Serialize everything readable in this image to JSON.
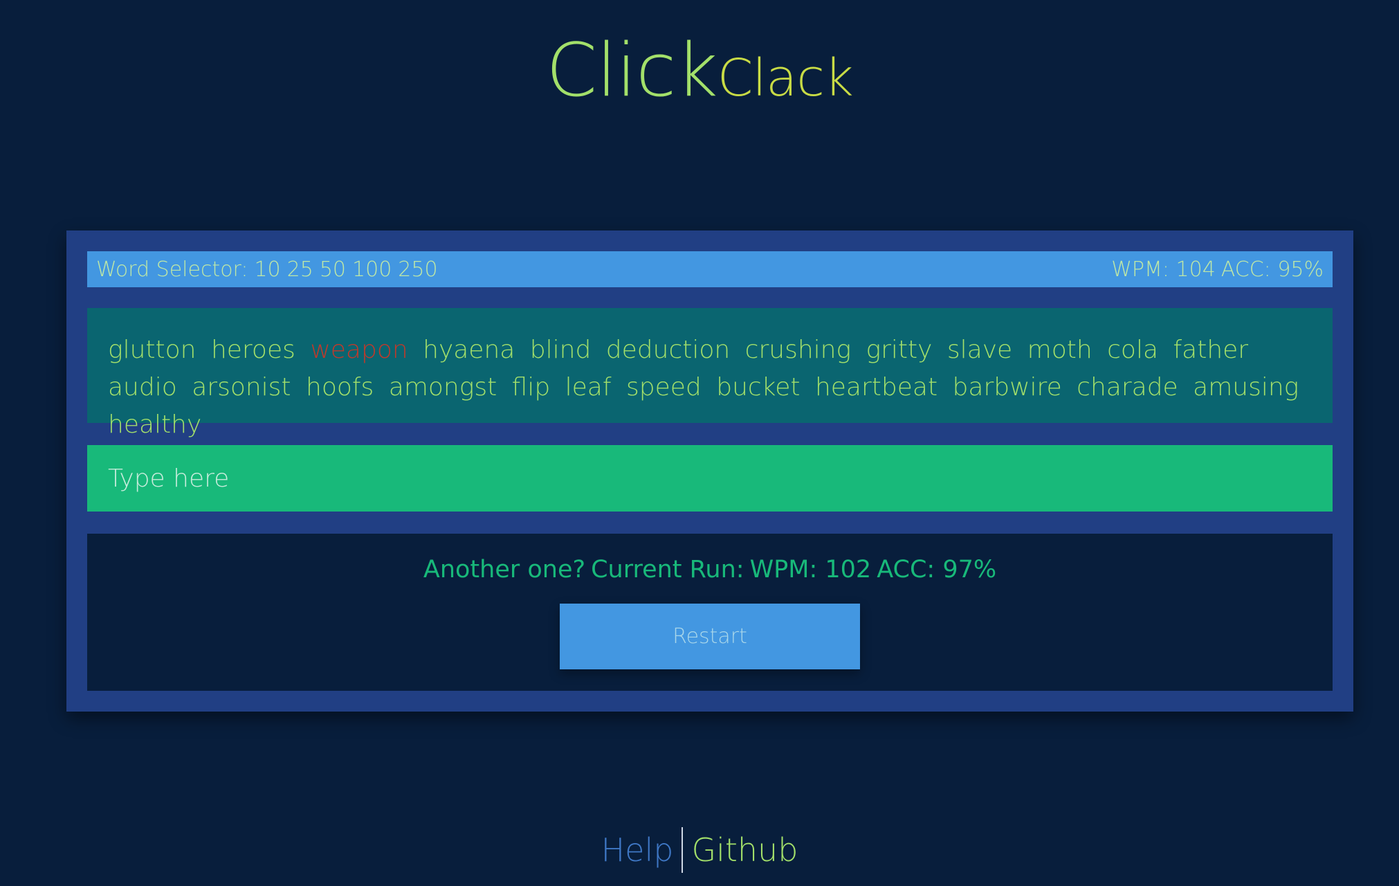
{
  "logo": {
    "click": "Click",
    "clack": "Clack"
  },
  "topbar": {
    "word_selector_label": "Word Selector:",
    "word_options": [
      "10",
      "25",
      "50",
      "100",
      "250"
    ],
    "wpm": "WPM: 104",
    "acc": "ACC: 95%"
  },
  "words": [
    "glutton",
    "heroes",
    "weapon",
    "hyaena",
    "blind",
    "deduction",
    "crushing",
    "gritty",
    "slave",
    "moth",
    "cola",
    "father",
    "audio",
    "arsonist",
    "hoofs",
    "amongst",
    "flip",
    "leaf",
    "speed",
    "bucket",
    "heartbeat",
    "barbwire",
    "charade",
    "amusing",
    "healthy"
  ],
  "error_word_index": 2,
  "input": {
    "placeholder": "Type here",
    "value": ""
  },
  "result": {
    "prompt": "Another one?",
    "run_label": "Current Run:",
    "wpm": "WPM: 102",
    "acc": "ACC: 97%",
    "restart_label": "Restart"
  },
  "footer": {
    "help": "Help",
    "github": "Github"
  },
  "colors": {
    "background": "#081e3c",
    "panel": "#213f84",
    "topbar": "#4397e1",
    "words_bg": "#0a6570",
    "input_bg": "#18b97a",
    "word_text": "#a3e06a",
    "error_text": "#c0392b"
  }
}
